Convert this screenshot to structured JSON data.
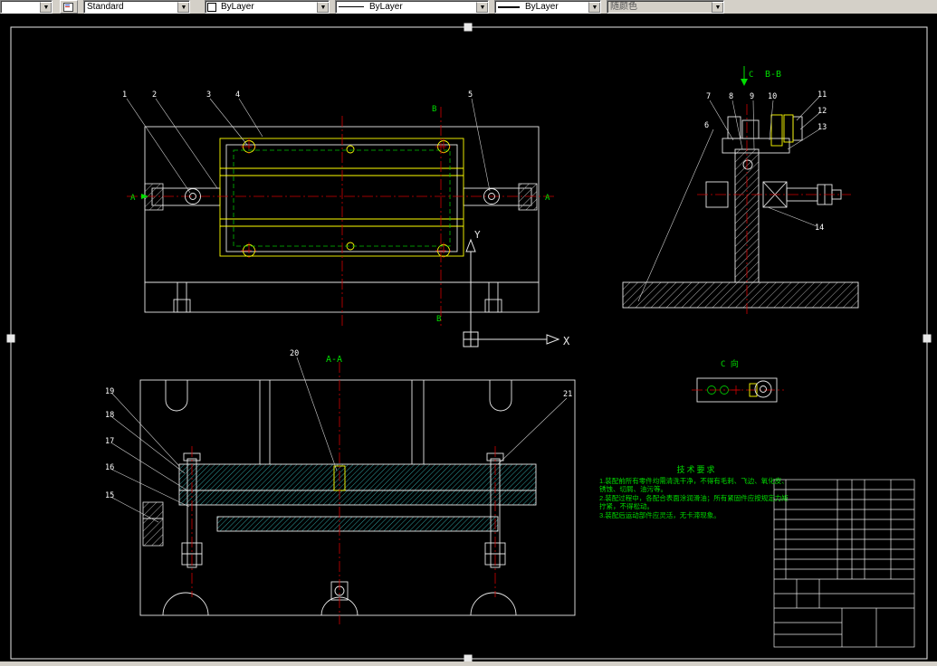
{
  "toolbar": {
    "left_combo": "",
    "style_combo": "Standard",
    "color_combo": "ByLayer",
    "linetype_combo": "ByLayer",
    "lineweight_combo": "ByLayer",
    "plotstyle_combo": "随颜色"
  },
  "drawing": {
    "labels": {
      "section_bb": "B-B",
      "section_aa": "A-A",
      "view_c": "C 向",
      "datum_a": "A",
      "datum_b": "B",
      "dir_c": "C"
    },
    "ucs": {
      "x": "X",
      "y": "Y"
    },
    "callouts_top": [
      "1",
      "2",
      "3",
      "4",
      "5"
    ],
    "callouts_right": [
      "6",
      "7",
      "8",
      "9",
      "10",
      "11",
      "12",
      "13",
      "14"
    ],
    "callouts_bottom": [
      "15",
      "16",
      "17",
      "18",
      "19",
      "20",
      "21"
    ],
    "tech_requirements": {
      "title": "技术要求",
      "items": [
        "1.装配前所有零件均需清洗干净，不得有毛刺、飞边、氧化皮、锈蚀、切屑、油污等。",
        "2.装配过程中，各配合表面涂润滑油；所有紧固件应按规定力矩拧紧，不得松动。",
        "3.装配后运动部件应灵活，无卡滞现象。"
      ]
    }
  }
}
